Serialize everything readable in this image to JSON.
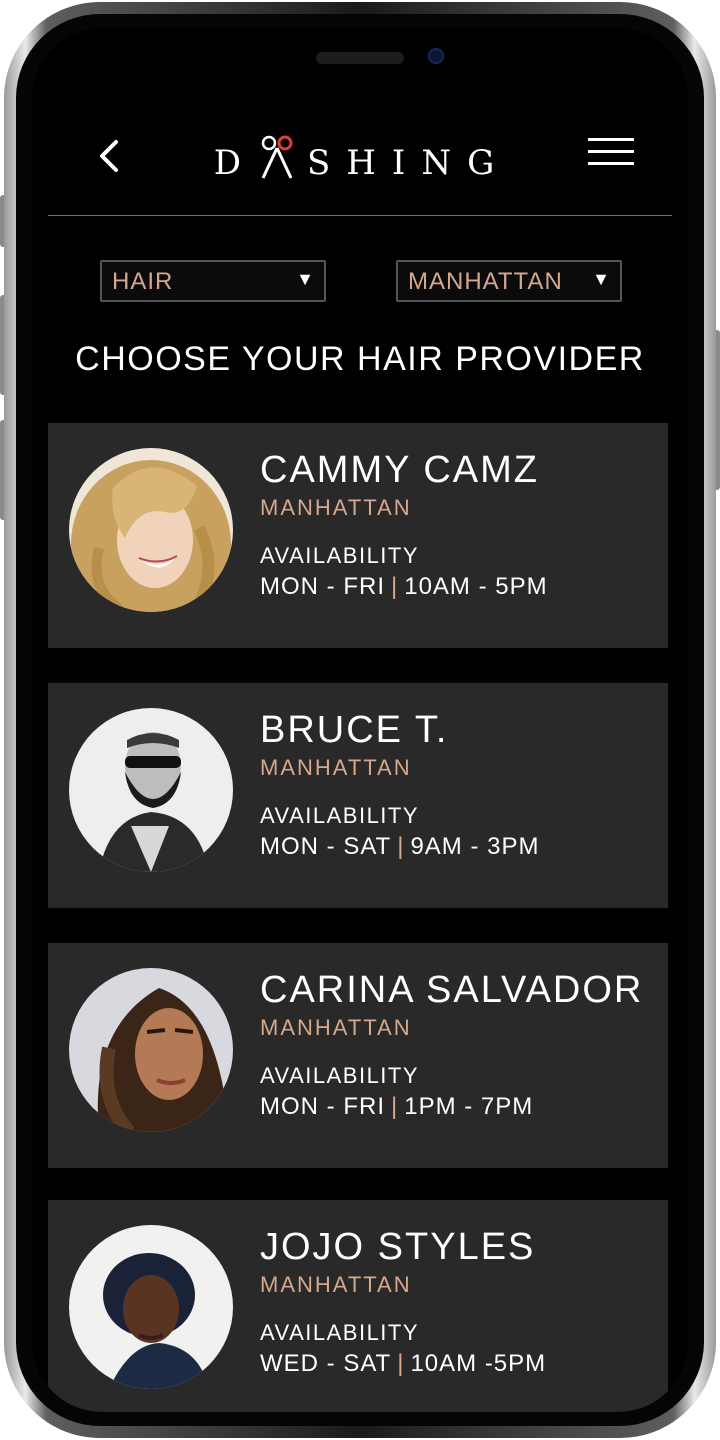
{
  "app": {
    "logo": "DASHING"
  },
  "filters": {
    "service": {
      "selected": "HAIR"
    },
    "location": {
      "selected": "MANHATTAN"
    }
  },
  "heading": "CHOOSE YOUR HAIR PROVIDER",
  "providers": [
    {
      "name": "CAMMY CAMZ",
      "location": "MANHATTAN",
      "availability_label": "AVAILABILITY",
      "days": "MON - FRI",
      "separator": "|",
      "hours": "10AM - 5PM"
    },
    {
      "name": "BRUCE T.",
      "location": "MANHATTAN",
      "availability_label": "AVAILABILITY",
      "days": "MON - SAT",
      "separator": "|",
      "hours": "9AM - 3PM"
    },
    {
      "name": "CARINA SALVADOR",
      "location": "MANHATTAN",
      "availability_label": "AVAILABILITY",
      "days": "MON - FRI",
      "separator": "|",
      "hours": "1PM - 7PM"
    },
    {
      "name": "JOJO STYLES",
      "location": "MANHATTAN",
      "availability_label": "AVAILABILITY",
      "days": "WED - SAT",
      "separator": "|",
      "hours": "10AM -5PM"
    }
  ],
  "colors": {
    "accent": "#d5a88e",
    "card_background": "#292929",
    "screen_background": "#000000",
    "logo_scissors": "#e03a3a"
  },
  "icons": {
    "back": "chevron-left-icon",
    "menu": "hamburger-menu-icon",
    "dropdown": "triangle-down-icon",
    "logo": "scissors-icon"
  }
}
